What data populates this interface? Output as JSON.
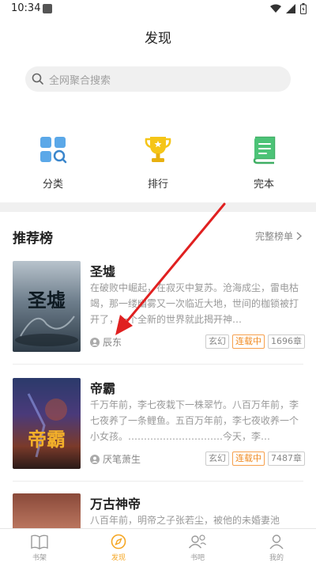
{
  "status": {
    "time": "10:34"
  },
  "header": {
    "title": "发现"
  },
  "search": {
    "placeholder": "全网聚合搜索"
  },
  "categories": [
    {
      "label": "分类",
      "icon": "category-grid-icon"
    },
    {
      "label": "排行",
      "icon": "trophy-icon"
    },
    {
      "label": "完本",
      "icon": "book-icon"
    }
  ],
  "recommend": {
    "title": "推荐榜",
    "more": "完整榜单",
    "books": [
      {
        "name": "圣墟",
        "desc": "在破败中崛起，在寂灭中复苏。沧海成尘，雷电枯竭，那一缕幽雾又一次临近大地，世间的枷锁被打开了，一个全新的世界就此揭开神…",
        "author": "辰东",
        "genre": "玄幻",
        "status": "连载中",
        "chapters": "1696章",
        "cover_title": "圣墟"
      },
      {
        "name": "帝霸",
        "desc": "千万年前，李七夜栽下一株翠竹。八百万年前，李七夜养了一条鲤鱼。五百万年前，李七夜收养一个小女孩。…………………………今天，李…",
        "author": "厌笔萧生",
        "genre": "玄幻",
        "status": "连载中",
        "chapters": "7487章",
        "cover_title": "帝霸"
      },
      {
        "name": "万古神帝",
        "desc": "八百年前，明帝之子张若尘，被他的未婚妻池",
        "author": "",
        "genre": "",
        "status": "",
        "chapters": "",
        "cover_title": ""
      }
    ]
  },
  "tabbar": [
    {
      "label": "书架",
      "icon": "bookshelf-icon",
      "active": false
    },
    {
      "label": "发现",
      "icon": "compass-icon",
      "active": true
    },
    {
      "label": "书吧",
      "icon": "community-icon",
      "active": false
    },
    {
      "label": "我的",
      "icon": "profile-icon",
      "active": false
    }
  ],
  "colors": {
    "accent": "#f5a623",
    "ongoing": "#f08a20"
  }
}
